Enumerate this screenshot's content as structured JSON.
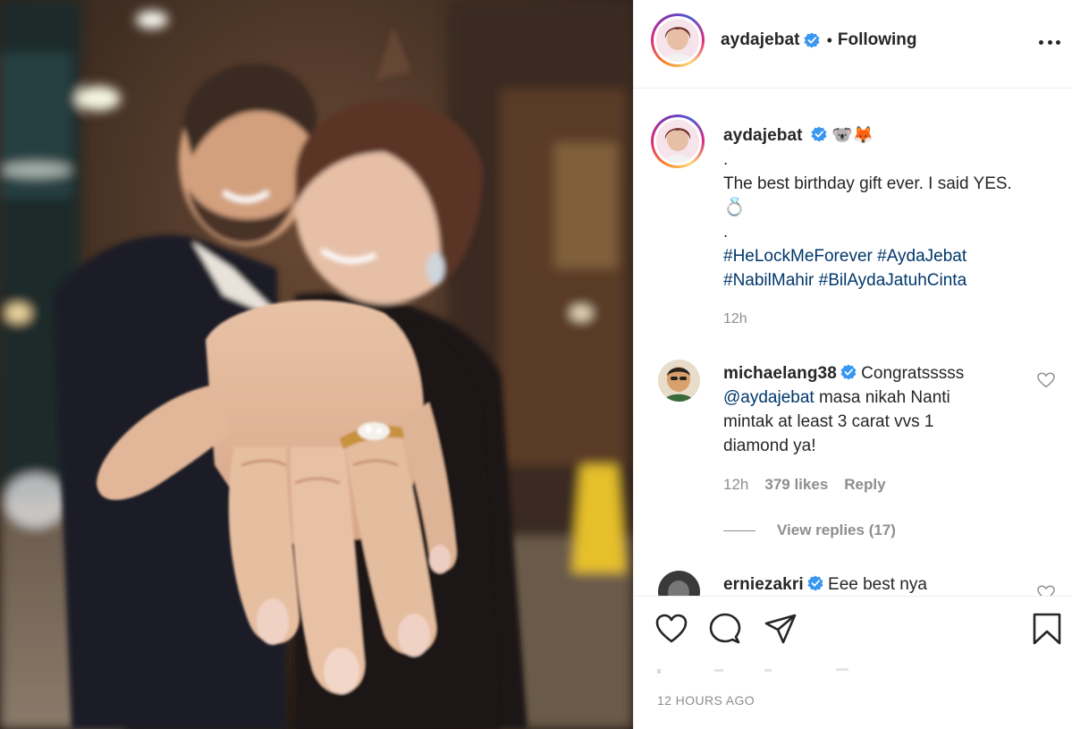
{
  "post": {
    "author": {
      "username": "aydajebat",
      "verified": true,
      "follow_status": "Following"
    },
    "caption": {
      "emojis": "🐨🦊",
      "lines": [
        ".",
        "The best birthday gift ever. I said YES.",
        "💍",
        "."
      ],
      "hashtags_line1": "#HeLockMeForever #AydaJebat",
      "hashtags_line2": "#NabilMahir #BilAydaJatuhCinta",
      "time": "12h"
    },
    "comments": [
      {
        "username": "michaelang38",
        "verified": true,
        "text_first": "Congratsssss",
        "mention": "@aydajebat",
        "text_rest_1": " masa nikah Nanti",
        "text_rest_2": "mintak at least 3 carat vvs 1",
        "text_rest_3": "diamond ya!",
        "time": "12h",
        "likes": "379 likes",
        "reply_label": "Reply",
        "view_replies": "View replies (17)"
      },
      {
        "username": "erniezakri",
        "verified": true,
        "text_first": "Eee best nya"
      }
    ],
    "posted_ago": "12 HOURS AGO"
  },
  "colors": {
    "text": "#262626",
    "muted": "#8e8e8e",
    "hashtag": "#00376b",
    "verified": "#3897f0",
    "divider": "#efefef"
  },
  "icons": [
    "more-options-icon",
    "verified-badge-icon",
    "heart-icon",
    "comment-icon",
    "share-icon",
    "bookmark-icon"
  ]
}
